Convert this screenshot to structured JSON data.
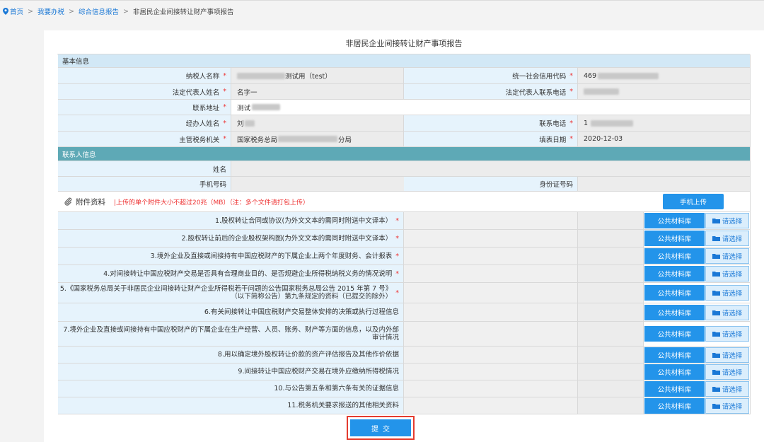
{
  "breadcrumb": {
    "home": "首页",
    "sep": ">",
    "items": [
      "我要办税",
      "综合信息报告"
    ],
    "current": "非居民企业间接转让财产事项报告"
  },
  "page_title": "非居民企业间接转让财产事项报告",
  "required_mark": "*",
  "basic": {
    "header": "基本信息",
    "taxpayer_name_label": "纳税人名称",
    "taxpayer_name_value": "测试用（test）",
    "credit_code_label": "统一社会信用代码",
    "credit_code_value": "469",
    "legal_rep_label": "法定代表人姓名",
    "legal_rep_value": "名字一",
    "legal_phone_label": "法定代表人联系电话",
    "address_label": "联系地址",
    "address_value": "测试",
    "handler_label": "经办人姓名",
    "handler_value": "刘",
    "phone_label": "联系电话",
    "phone_value": "1",
    "tax_office_label": "主管税务机关",
    "tax_office_value_left": "国家税务总局",
    "tax_office_value_right": "分局",
    "fill_date_label": "填表日期",
    "fill_date_value": "2020-12-03"
  },
  "contact": {
    "header": "联系人信息",
    "name_label": "姓名",
    "mobile_label": "手机号码",
    "id_label": "身份证号码"
  },
  "attachments": {
    "title": "附件资料",
    "note": "|上传的单个附件大小不超过20兆（MB）（注：多个文件请打包上传）",
    "mobile_upload": "手机上传",
    "public_btn": "公共材料库",
    "choose_btn": "请选择",
    "items": [
      "1.股权转让合同或协议(为外文文本的需同时附送中文译本）",
      "2.股权转让前后的企业股权架构图(为外文文本的需同时附送中文译本）",
      "3.境外企业及直接或间接持有中国应税财产的下属企业上两个年度财务、会计报表",
      "4.对间接转让中国应税财产交易是否具有合理商业目的、是否规避企业所得税纳税义务的情况说明",
      "5.《国家税务总局关于非居民企业间接转让财产企业所得税若干问题的公告国家税务总局公告 2015 年第 7 号》（以下简称公告）第九条规定的资料（已提交的除外）",
      "6.有关间接转让中国应税财产交易整体安排的决策或执行过程信息",
      "7.境外企业及直接或间接持有中国应税财产的下属企业在生产经营、人员、账务、财产等方面的信息，以及内外部审计情况",
      "8.用以确定境外股权转让价款的资产评估报告及其他作价依据",
      "9.间接转让中国应税财产交易在境外应缴纳所得税情况",
      "10.与公告第五条和第六条有关的证据信息",
      "11.税务机关要求报送的其他相关资料"
    ],
    "required": [
      true,
      true,
      true,
      true,
      true,
      false,
      false,
      false,
      false,
      false,
      false
    ]
  },
  "submit": "提交",
  "colors": {
    "accent": "#2394ea",
    "label_bg": "#e6f3fc",
    "contact_header": "#5ea9b6",
    "highlight": "#e43b2f"
  }
}
